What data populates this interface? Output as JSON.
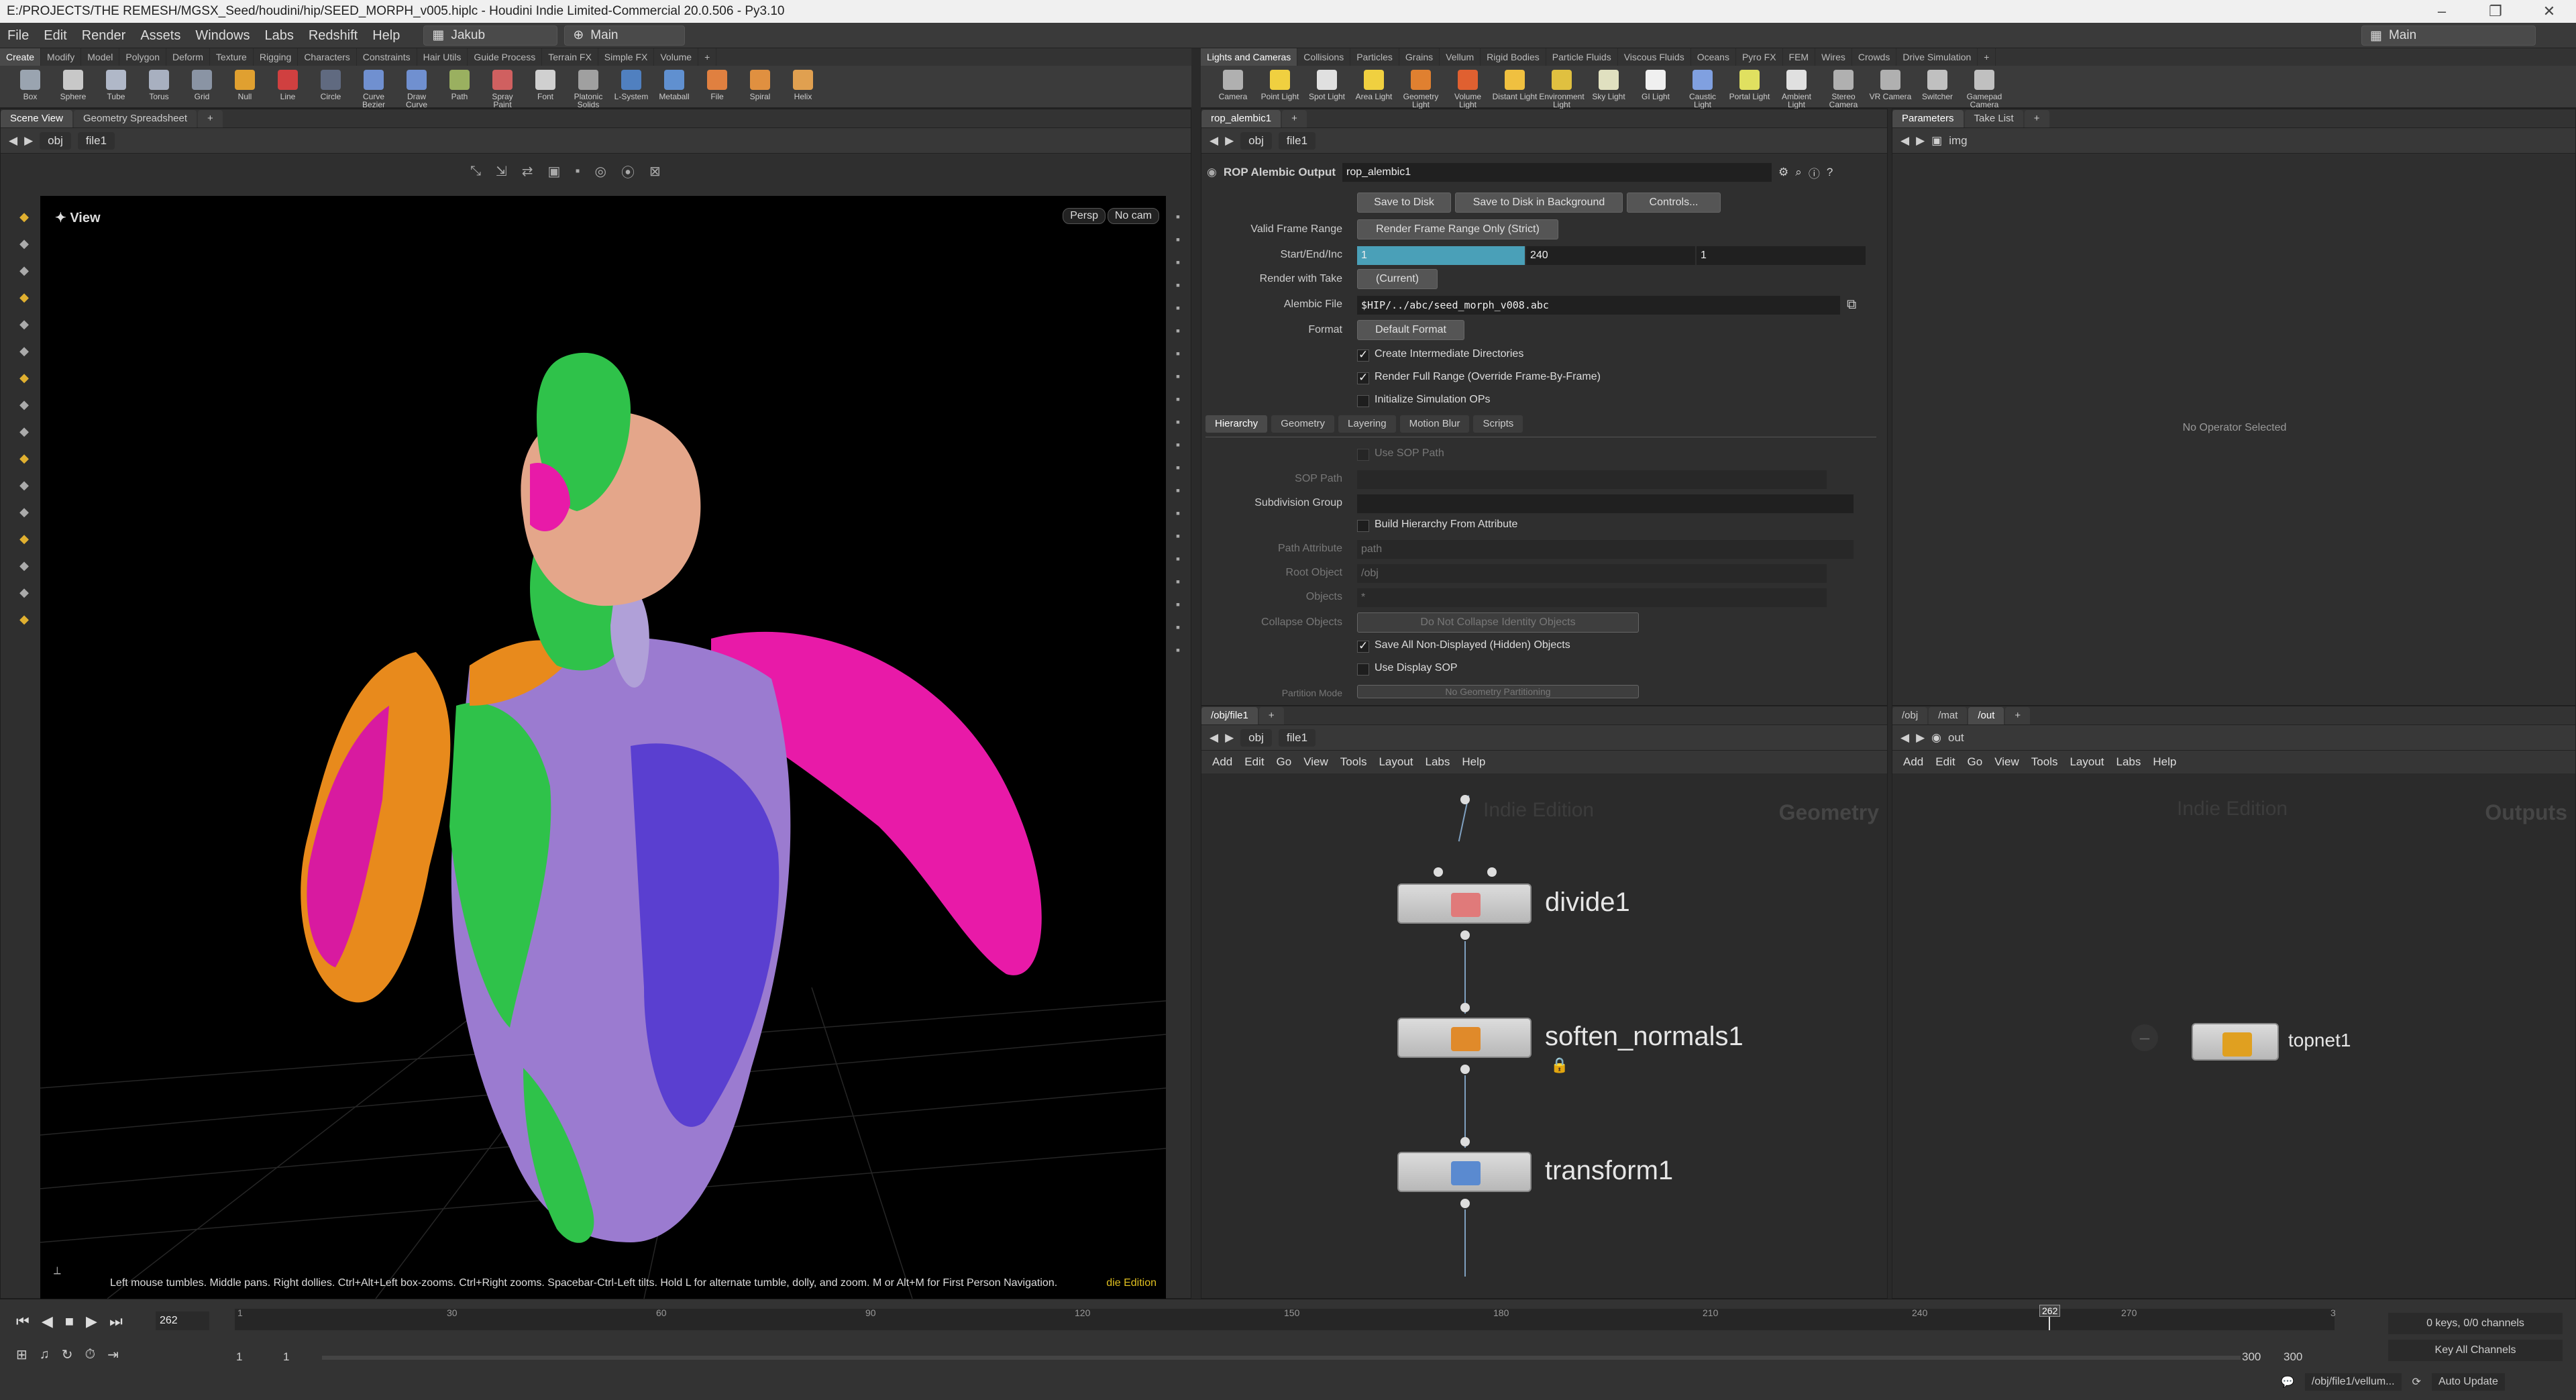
{
  "titlebar": {
    "text": "E:/PROJECTS/THE REMESH/MGSX_Seed/houdini/hip/SEED_MORPH_v005.hiplc - Houdini Indie Limited-Commercial 20.0.506 - Py3.10"
  },
  "menubar": {
    "items": [
      "File",
      "Edit",
      "Render",
      "Assets",
      "Windows",
      "Labs",
      "Redshift",
      "Help"
    ],
    "user_dropdown": "Jakub",
    "desktop_dropdown": "Main",
    "right_desktop": "Main"
  },
  "shelf_left": {
    "tabs": [
      "Create",
      "Modify",
      "Model",
      "Polygon",
      "Deform",
      "Texture",
      "Rigging",
      "Characters",
      "Constraints",
      "Hair Utils",
      "Guide Process",
      "Terrain FX",
      "Simple FX",
      "Volume"
    ],
    "tools": [
      {
        "label": "Box",
        "icon": "box-icon",
        "color": "#9aa4b0"
      },
      {
        "label": "Sphere",
        "icon": "sphere-icon",
        "color": "#c8c8c8"
      },
      {
        "label": "Tube",
        "icon": "tube-icon",
        "color": "#b0b8c8"
      },
      {
        "label": "Torus",
        "icon": "torus-icon",
        "color": "#a8b0c0"
      },
      {
        "label": "Grid",
        "icon": "grid-icon",
        "color": "#8a94a4"
      },
      {
        "label": "Null",
        "icon": "null-icon",
        "color": "#e0a030"
      },
      {
        "label": "Line",
        "icon": "line-icon",
        "color": "#d04040"
      },
      {
        "label": "Circle",
        "icon": "circle-icon",
        "color": "#606a80"
      },
      {
        "label": "Curve Bezier",
        "icon": "curve-bezier-icon",
        "color": "#7090d0"
      },
      {
        "label": "Draw Curve",
        "icon": "draw-curve-icon",
        "color": "#7090d0"
      },
      {
        "label": "Path",
        "icon": "path-icon",
        "color": "#9ab060"
      },
      {
        "label": "Spray Paint",
        "icon": "spray-paint-icon",
        "color": "#d06060"
      },
      {
        "label": "Font",
        "icon": "font-icon",
        "color": "#d0d0d0"
      },
      {
        "label": "Platonic Solids",
        "icon": "platonic-icon",
        "color": "#a0a0a0"
      },
      {
        "label": "L-System",
        "icon": "lsystem-icon",
        "color": "#5080c0"
      },
      {
        "label": "Metaball",
        "icon": "metaball-icon",
        "color": "#6090d0"
      },
      {
        "label": "File",
        "icon": "file-icon",
        "color": "#e08040"
      },
      {
        "label": "Spiral",
        "icon": "spiral-icon",
        "color": "#e09040"
      },
      {
        "label": "Helix",
        "icon": "helix-icon",
        "color": "#e0a050"
      }
    ]
  },
  "shelf_right": {
    "tabs": [
      "Lights and Cameras",
      "Collisions",
      "Particles",
      "Grains",
      "Vellum",
      "Rigid Bodies",
      "Particle Fluids",
      "Viscous Fluids",
      "Oceans",
      "Pyro FX",
      "FEM",
      "Wires",
      "Crowds",
      "Drive Simulation"
    ],
    "tools": [
      {
        "label": "Camera",
        "icon": "camera-icon",
        "color": "#b0b0b0"
      },
      {
        "label": "Point Light",
        "icon": "point-light-icon",
        "color": "#f0d040"
      },
      {
        "label": "Spot Light",
        "icon": "spot-light-icon",
        "color": "#e0e0e0"
      },
      {
        "label": "Area Light",
        "icon": "area-light-icon",
        "color": "#f0d040"
      },
      {
        "label": "Geometry Light",
        "icon": "geometry-light-icon",
        "color": "#e08030"
      },
      {
        "label": "Volume Light",
        "icon": "volume-light-icon",
        "color": "#e06030"
      },
      {
        "label": "Distant Light",
        "icon": "distant-light-icon",
        "color": "#f0c040"
      },
      {
        "label": "Environment Light",
        "icon": "environment-light-icon",
        "color": "#e0c040"
      },
      {
        "label": "Sky Light",
        "icon": "sky-light-icon",
        "color": "#e0e0c0"
      },
      {
        "label": "GI Light",
        "icon": "gi-light-icon",
        "color": "#f0f0f0"
      },
      {
        "label": "Caustic Light",
        "icon": "caustic-light-icon",
        "color": "#80a0e0"
      },
      {
        "label": "Portal Light",
        "icon": "portal-light-icon",
        "color": "#e0e060"
      },
      {
        "label": "Ambient Light",
        "icon": "ambient-light-icon",
        "color": "#e0e0e0"
      },
      {
        "label": "Stereo Camera",
        "icon": "stereo-camera-icon",
        "color": "#b0b0b0"
      },
      {
        "label": "VR Camera",
        "icon": "vr-camera-icon",
        "color": "#b0b0b0"
      },
      {
        "label": "Switcher",
        "icon": "switcher-icon",
        "color": "#c0c0c0"
      },
      {
        "label": "Gamepad Camera",
        "icon": "gamepad-camera-icon",
        "color": "#c0c0c0"
      }
    ]
  },
  "scene_view": {
    "tabs": [
      "Scene View",
      "Geometry Spreadsheet"
    ],
    "path": [
      "obj",
      "file1"
    ],
    "view_label": "View",
    "persp": "Persp",
    "cam": "No cam",
    "hint": "Left mouse tumbles. Middle pans. Right dollies. Ctrl+Alt+Left box-zooms. Ctrl+Right zooms. Spacebar-Ctrl-Left tilts. Hold L for alternate tumble, dolly, and zoom. M or Alt+M for First Person Navigation.",
    "edition": "die Edition"
  },
  "param_editor": {
    "tab": "rop_alembic1",
    "path": [
      "obj",
      "file1"
    ],
    "op_type": "ROP Alembic Output",
    "op_name": "rop_alembic1",
    "buttons": [
      "Save to Disk",
      "Save to Disk in Background",
      "Controls..."
    ],
    "valid_frame_range": {
      "label": "Valid Frame Range",
      "value": "Render Frame Range Only (Strict)"
    },
    "start_end_inc": {
      "label": "Start/End/Inc",
      "start": "1",
      "end": "240",
      "inc": "1"
    },
    "render_with_take": {
      "label": "Render with Take",
      "value": "(Current)"
    },
    "alembic_file": {
      "label": "Alembic File",
      "value": "$HIP/../abc/seed_morph_v008.abc"
    },
    "format": {
      "label": "Format",
      "value": "Default Format"
    },
    "checks": [
      {
        "label": "Create Intermediate Directories",
        "on": true
      },
      {
        "label": "Render Full Range (Override Frame-By-Frame)",
        "on": true
      },
      {
        "label": "Initialize Simulation OPs",
        "on": false
      }
    ],
    "subtabs": [
      "Hierarchy",
      "Geometry",
      "Layering",
      "Motion Blur",
      "Scripts"
    ],
    "use_sop_path": "Use SOP Path",
    "sop_path": "SOP Path",
    "subdivision_group": "Subdivision Group",
    "build_hierarchy": "Build Hierarchy From Attribute",
    "path_attribute": {
      "label": "Path Attribute",
      "value": "path"
    },
    "root_object": {
      "label": "Root Object",
      "value": "/obj"
    },
    "objects": {
      "label": "Objects",
      "value": "*"
    },
    "collapse_objects": {
      "label": "Collapse Objects",
      "value": "Do Not Collapse Identity Objects"
    },
    "save_hidden": "Save All Non-Displayed (Hidden) Objects",
    "use_display_sop": "Use Display SOP",
    "partition_mode": {
      "label": "Partition Mode",
      "value": "No Geometry Partitioning"
    }
  },
  "params_pane": {
    "tabs": [
      "Parameters",
      "Take List"
    ],
    "path": "img",
    "empty_text": "No Operator Selected"
  },
  "network_geo": {
    "tab": "/obj/file1",
    "path": [
      "obj",
      "file1"
    ],
    "menu": [
      "Add",
      "Edit",
      "Go",
      "View",
      "Tools",
      "Layout",
      "Labs",
      "Help"
    ],
    "watermark": "Indie Edition",
    "context": "Geometry",
    "nodes": [
      {
        "name": "divide1",
        "icon": "divide-icon"
      },
      {
        "name": "soften_normals1",
        "icon": "soften-normals-icon"
      },
      {
        "name": "transform1",
        "icon": "transform-icon"
      }
    ]
  },
  "network_out": {
    "tabs": [
      "/obj",
      "/mat",
      "/out"
    ],
    "path": "out",
    "menu": [
      "Add",
      "Edit",
      "Go",
      "View",
      "Tools",
      "Layout",
      "Labs",
      "Help"
    ],
    "watermark": "Indie Edition",
    "context": "Outputs",
    "node": "topnet1"
  },
  "timeline": {
    "current_frame": "262",
    "start": "1",
    "start2": "1",
    "end": "300",
    "end2": "300",
    "ticks": [
      "1",
      "30",
      "60",
      "90",
      "120",
      "150",
      "180",
      "210",
      "240",
      "270",
      "3"
    ],
    "marker": "262",
    "keys_info": "0 keys, 0/0 channels",
    "key_all": "Key All Channels",
    "status_path": "/obj/file1/vellum...",
    "auto_update": "Auto Update"
  }
}
